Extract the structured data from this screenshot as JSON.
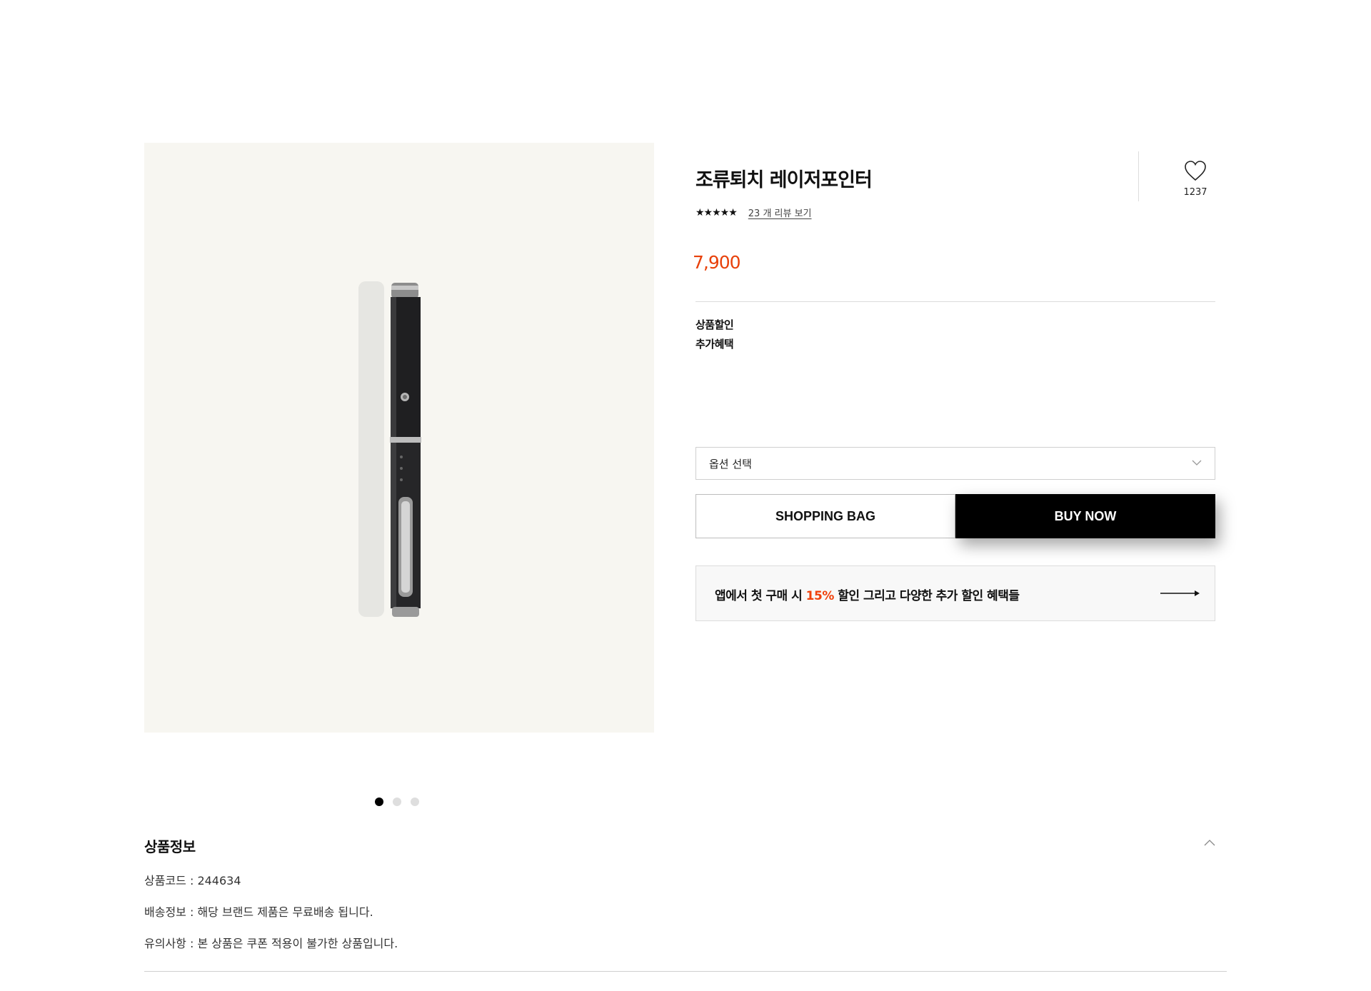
{
  "product": {
    "title": "조류퇴치 레이저포인터",
    "rating_stars": "★★★★★",
    "review_link": "23 개 리뷰 보기",
    "wish_count": "1237",
    "price": "7,900",
    "benefits": [
      "상품할인",
      "추가혜택"
    ]
  },
  "options": {
    "placeholder": "옵션 선택"
  },
  "buttons": {
    "shopping_bag": "SHOPPING BAG",
    "buy_now": "BUY NOW"
  },
  "promo": {
    "text_before": "앱에서 첫 구매 시 ",
    "highlight": "15%",
    "text_after": " 할인 그리고 다양한 추가 할인 혜택들"
  },
  "carousel": {
    "count": 3,
    "active_index": 0
  },
  "info_section": {
    "title": "상품정보",
    "lines": [
      "상품코드 : 244634",
      "배송정보 : 해당 브랜드 제품은 무료배송 됩니다.",
      "유의사항 : 본 상품은 쿠폰 적용이 불가한 상품입니다."
    ]
  },
  "colors": {
    "price": "#e8410b",
    "promo_highlight": "#f0410b",
    "buy_button": "#000000"
  },
  "icons": {
    "wish": "heart-outline-icon",
    "select": "chevron-down-icon",
    "promo": "arrow-right-icon",
    "section_toggle": "chevron-up-icon"
  }
}
